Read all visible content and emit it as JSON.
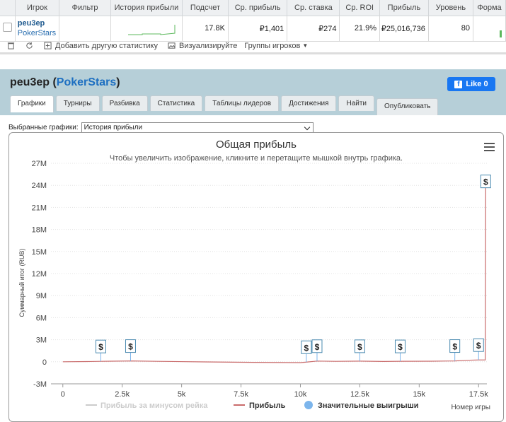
{
  "stats_table": {
    "headers": [
      "Игрок",
      "Фильтр",
      "История прибыли",
      "Подсчет",
      "Ср. прибыль",
      "Ср. ставка",
      "Ср. ROI",
      "Прибыль",
      "Уровень",
      "Форма"
    ],
    "row": {
      "player_name": "peu3ep",
      "player_site": "PokerStars",
      "count": "17.8K",
      "avg_profit": "₽1,401",
      "avg_stake": "₽274",
      "avg_roi": "21.9%",
      "profit": "₽25,016,736",
      "level": "80"
    }
  },
  "toolbar": {
    "add_stat": "Добавить другую статистику",
    "visualize": "Визуализируйте",
    "player_groups": "Группы игроков"
  },
  "profile": {
    "name": "peu3ep",
    "site": "PokerStars",
    "like_label": "Like 0"
  },
  "tabs": [
    "Графики",
    "Турниры",
    "Разбивка",
    "Статистика",
    "Таблицы лидеров",
    "Достижения",
    "Найти",
    "Опубликовать"
  ],
  "chart_select": {
    "label": "Выбранные графики:",
    "value": "История прибыли"
  },
  "colors": {
    "profit_line": "#c96b6b",
    "rake_line": "#cccccc",
    "big_wins_marker": "#7cb5ec",
    "accent_link": "#1d6fc1",
    "panel_bg": "#b6cfd8",
    "like_bg": "#1877f2"
  },
  "chart_data": {
    "type": "line",
    "title": "Общая прибыль",
    "subtitle": "Чтобы увеличить изображение, кликните и перетащите мышкой внутрь графика.",
    "xlabel": "Номер игры",
    "ylabel": "Суммарный итог (RUB)",
    "x_ticks": [
      "0",
      "2.5k",
      "5k",
      "7.5k",
      "10k",
      "12.5k",
      "15k",
      "17.5k"
    ],
    "x_tick_values": [
      0,
      2500,
      5000,
      7500,
      10000,
      12500,
      15000,
      17500
    ],
    "y_ticks": [
      "-3M",
      "0",
      "3M",
      "6M",
      "9M",
      "12M",
      "15M",
      "18M",
      "21M",
      "24M",
      "27M"
    ],
    "y_tick_values": [
      -3000000,
      0,
      3000000,
      6000000,
      9000000,
      12000000,
      15000000,
      18000000,
      21000000,
      24000000,
      27000000
    ],
    "xlim": [
      -500,
      17850
    ],
    "ylim": [
      -3000000,
      27000000
    ],
    "series": [
      {
        "name": "Прибыль за минусом рейка",
        "visible": false,
        "values": []
      },
      {
        "name": "Прибыль",
        "x": [
          0,
          1000,
          1600,
          2000,
          2900,
          4000,
          6000,
          8000,
          10000,
          10300,
          10700,
          11500,
          12500,
          13500,
          14200,
          15500,
          16500,
          17000,
          17500,
          17780,
          17800,
          17830
        ],
        "y": [
          0,
          30000,
          60000,
          80000,
          120000,
          60000,
          -20000,
          -80000,
          -120000,
          -30000,
          100000,
          60000,
          90000,
          40000,
          70000,
          80000,
          120000,
          200000,
          250000,
          250000,
          25016736,
          25016736
        ]
      }
    ],
    "big_wins": {
      "name": "Значительные выигрыши",
      "x": [
        1600,
        2850,
        10250,
        10700,
        12500,
        14200,
        16500,
        17500,
        17800
      ],
      "marker_label": "$"
    },
    "legend_position": "bottom",
    "grid": "horizontal dotted"
  }
}
